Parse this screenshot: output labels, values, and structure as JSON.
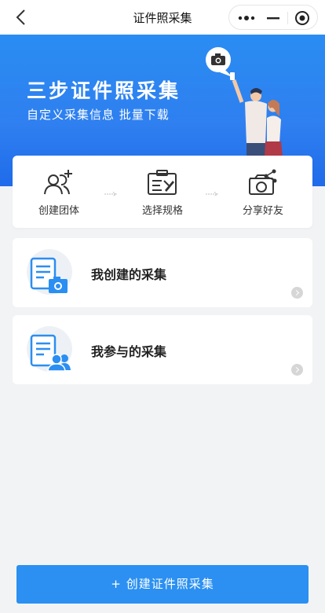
{
  "nav": {
    "title": "证件照采集"
  },
  "banner": {
    "title": "三步证件照采集",
    "subtitle": "自定义采集信息 批量下载"
  },
  "steps": [
    {
      "label": "创建团体",
      "icon": "add-group-icon"
    },
    {
      "label": "选择规格",
      "icon": "id-card-edit-icon"
    },
    {
      "label": "分享好友",
      "icon": "share-camera-icon"
    }
  ],
  "cards": [
    {
      "title": "我创建的采集",
      "icon": "document-camera-icon"
    },
    {
      "title": "我参与的采集",
      "icon": "document-users-icon"
    }
  ],
  "create_button": {
    "plus": "+",
    "label": "创建证件照采集"
  },
  "colors": {
    "accent": "#2b90f1",
    "banner": "#2f7ff0",
    "icon_blue": "#2b8ef2"
  }
}
